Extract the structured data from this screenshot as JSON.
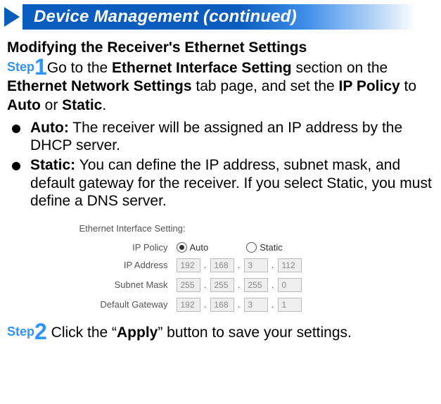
{
  "header": {
    "title": "Device Management (continued)"
  },
  "section": {
    "title": "Modifying the Receiver's Ethernet Settings"
  },
  "step1": {
    "step_word": "Step",
    "num": "1",
    "t1": "Go  to the ",
    "b1": "Ethernet Interface Setting",
    "t2": " section on the ",
    "b2": "Ethernet Network Settings",
    "t3": " tab page, and set the ",
    "b3": "IP Policy",
    "t4": " to ",
    "b4": "Auto",
    "t5": " or ",
    "b5": "Static",
    "t6": "."
  },
  "bullets": {
    "auto_label": "Auto:",
    "auto_text": " The receiver will be assigned an IP address by the DHCP server.",
    "static_label": "Static:",
    "static_text": " You can define the IP address, subnet mask, and default gateway for the receiver. If you select Static, you must define a DNS server."
  },
  "panel": {
    "title": "Ethernet Interface Setting:",
    "policy_label": "IP Policy",
    "auto": "Auto",
    "static": "Static",
    "ip_label": "IP Address",
    "ip": [
      "192",
      "168",
      "3",
      "112"
    ],
    "mask_label": "Subnet Mask",
    "mask": [
      "255",
      "255",
      "255",
      "0"
    ],
    "gw_label": "Default Gateway",
    "gw": [
      "192",
      "168",
      "3",
      "1"
    ]
  },
  "step2": {
    "step_word": "Step",
    "num": "2",
    "t1": " Click the “",
    "b1": "Apply",
    "t2": "” button to save your settings."
  }
}
